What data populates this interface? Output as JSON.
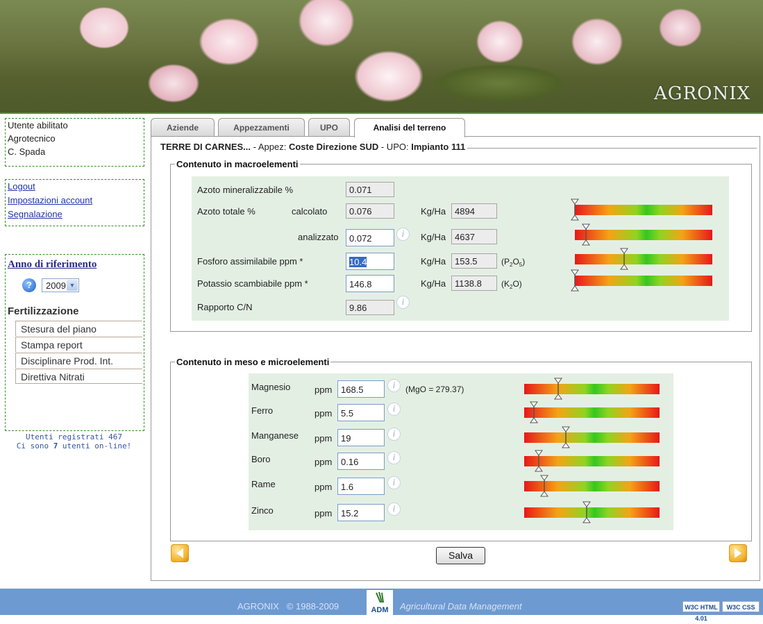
{
  "banner": {
    "logo": "AGRONIX"
  },
  "user": {
    "line1": "Utente abilitato",
    "line2": "Agrotecnico",
    "line3": "C. Spada"
  },
  "links": {
    "logout": "Logout",
    "settings": "Impostazioni account",
    "report": "Segnalazione"
  },
  "year": {
    "title": "Anno di riferimento",
    "help": "?",
    "selected": "2009"
  },
  "fert": {
    "title": "Fertilizzazione",
    "items": [
      "Stesura del piano",
      "Stampa report",
      "Disciplinare Prod. Int.",
      "Direttiva Nitrati"
    ]
  },
  "online": {
    "registered": "Utenti registrati 467",
    "online_pre": "Ci sono ",
    "online_count": "7",
    "online_post": " utenti on-line!"
  },
  "tabs": [
    "Aziende",
    "Appezzamenti",
    "UPO",
    "Analisi del terreno"
  ],
  "context": {
    "farm": "TERRE DI CARNES...",
    "sep1": " - Appez: ",
    "plot": "Coste Direzione SUD",
    "sep2": " - UPO: ",
    "upo": "Impianto 111"
  },
  "macro": {
    "legend": "Contenuto in macroelementi",
    "azoto_min_label": "Azoto mineralizzabile %",
    "azoto_min_value": "0.071",
    "azoto_tot_label": "Azoto totale %",
    "calcolato_label": "calcolato",
    "calcolato_value": "0.076",
    "calcolato_kgha": "4894",
    "analizzato_label": "analizzato",
    "analizzato_value": "0.072",
    "analizzato_kgha": "4637",
    "fosforo_label": "Fosforo assimilabile ppm *",
    "fosforo_value": "10.4",
    "fosforo_kgha": "153.5",
    "fosforo_unit_pre": "(P",
    "fosforo_sub1": "2",
    "fosforo_mid": "O",
    "fosforo_sub2": "5",
    "fosforo_unit_post": ")",
    "potassio_label": "Potassio scambiabile ppm *",
    "potassio_value": "146.8",
    "potassio_kgha": "1138.8",
    "potassio_unit_pre": "(K",
    "potassio_sub": "2",
    "potassio_unit_post": "O)",
    "cn_label": "Rapporto C/N",
    "cn_value": "9.86",
    "kgha_label": "Kg/Ha",
    "info": "i",
    "levels": [
      0.0,
      0.08,
      0.36,
      0.0
    ]
  },
  "micro": {
    "legend": "Contenuto in meso e microelementi",
    "unit": "ppm",
    "info": "i",
    "mgo_note": "(MgO = 279.37)",
    "rows": [
      {
        "name": "Magnesio",
        "value": "168.5"
      },
      {
        "name": "Ferro",
        "value": "5.5"
      },
      {
        "name": "Manganese",
        "value": "19"
      },
      {
        "name": "Boro",
        "value": "0.16"
      },
      {
        "name": "Rame",
        "value": "1.6"
      },
      {
        "name": "Zinco",
        "value": "15.2"
      }
    ],
    "levels": [
      0.25,
      0.07,
      0.31,
      0.11,
      0.15,
      0.46
    ]
  },
  "actions": {
    "save": "Salva"
  },
  "footer": {
    "text": "AGRONIX   © 1988-2009",
    "adm": "ADM",
    "tagline": "Agricultural Data Management",
    "w3c_html": "W3C HTML 4.01",
    "w3c_css": "W3C CSS"
  }
}
